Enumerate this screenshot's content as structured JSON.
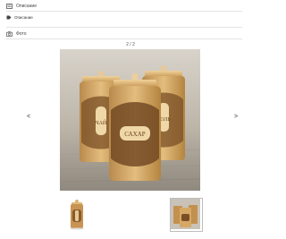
{
  "sections": {
    "description": {
      "label": "Описание",
      "icon": "document-icon"
    },
    "tags": {
      "label": "Описание",
      "icon": "tag-icon"
    },
    "photo": {
      "label": "Фото",
      "icon": "camera-icon"
    }
  },
  "gallery": {
    "counter": "2 / 2",
    "prev_label": "<",
    "next_label": ">"
  },
  "colors": {
    "background": "#ffffff",
    "divider": "#e4e4e4",
    "thumb_border": "#bdbdbd"
  }
}
